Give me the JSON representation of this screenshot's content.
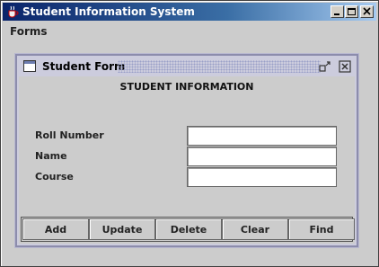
{
  "window": {
    "title": "Student Information System"
  },
  "menubar": {
    "items": [
      {
        "label": "Forms"
      }
    ]
  },
  "internal_frame": {
    "title": "Student Form",
    "heading": "STUDENT INFORMATION",
    "fields": [
      {
        "label": "Roll Number",
        "value": ""
      },
      {
        "label": "Name",
        "value": ""
      },
      {
        "label": "Course",
        "value": ""
      }
    ],
    "buttons": [
      {
        "label": "Add"
      },
      {
        "label": "Update"
      },
      {
        "label": "Delete"
      },
      {
        "label": "Clear"
      },
      {
        "label": "Find"
      }
    ]
  }
}
